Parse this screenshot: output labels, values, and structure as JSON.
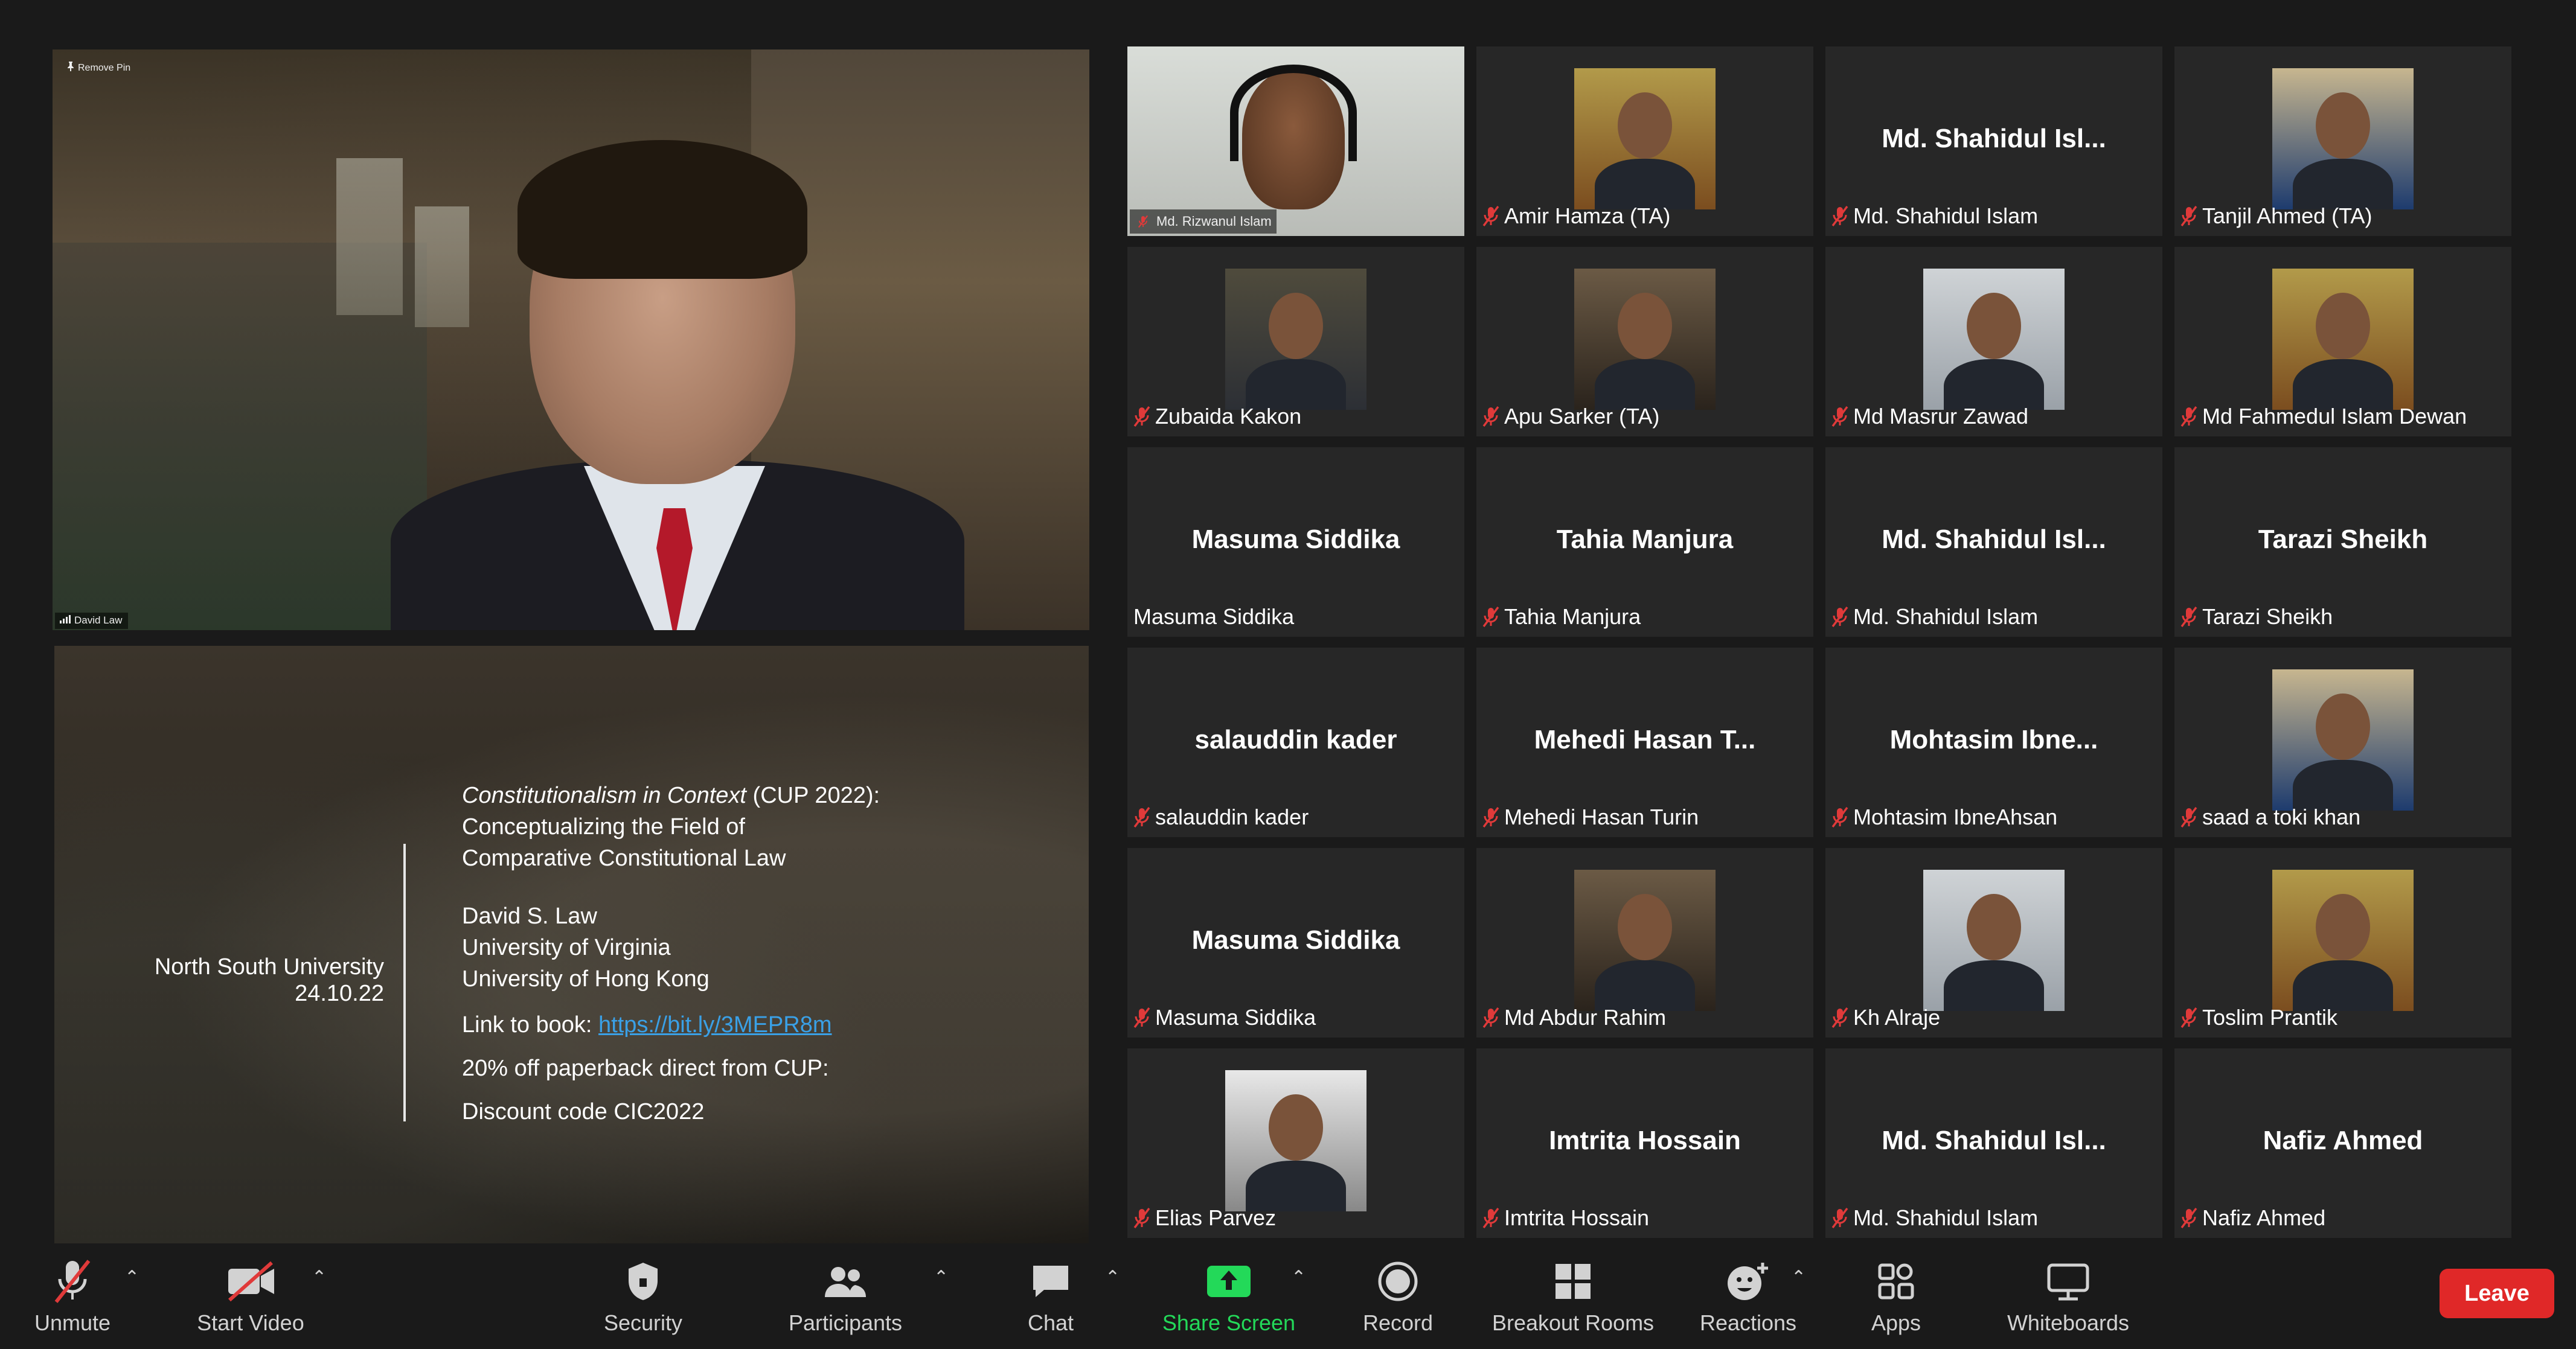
{
  "pinned_video": {
    "remove_pin_label": "Remove Pin",
    "speaker_name": "David Law"
  },
  "shared_screen": {
    "left_institution": "North South University",
    "left_date": "24.10.22",
    "title_italic": "Constitutionalism in Context",
    "title_rest": " (CUP 2022):",
    "title_line2": "Conceptualizing the Field of",
    "title_line3": "Comparative Constitutional Law",
    "author": "David S. Law",
    "affiliation_1": "University of Virginia",
    "affiliation_2": "University of Hong Kong",
    "link_label": "Link to book: ",
    "link_url": "https://bit.ly/3MEPR8m",
    "discount_line": "20% off paperback direct from CUP:",
    "discount_code": "Discount code CIC2022"
  },
  "participants": [
    {
      "label": "Md. Rizwanul Islam",
      "display": "video"
    },
    {
      "label": "Amir Hamza (TA)",
      "display": "photo"
    },
    {
      "label": "Md. Shahidul Islam",
      "big_name": "Md. Shahidul Isl..."
    },
    {
      "label": "Tanjil Ahmed (TA)",
      "display": "photo"
    },
    {
      "label": "Zubaida Kakon",
      "display": "photo"
    },
    {
      "label": "Apu Sarker (TA)",
      "display": "photo"
    },
    {
      "label": "Md Masrur Zawad",
      "display": "photo"
    },
    {
      "label": "Md Fahmedul Islam Dewan",
      "display": "photo"
    },
    {
      "label": "Masuma Siddika",
      "big_name": "Masuma Siddika"
    },
    {
      "label": "Tahia Manjura",
      "big_name": "Tahia Manjura"
    },
    {
      "label": "Md. Shahidul Islam",
      "big_name": "Md. Shahidul Isl..."
    },
    {
      "label": "Tarazi Sheikh",
      "big_name": "Tarazi Sheikh"
    },
    {
      "label": "salauddin kader",
      "big_name": "salauddin kader"
    },
    {
      "label": "Mehedi Hasan Turin",
      "big_name": "Mehedi Hasan T..."
    },
    {
      "label": "Mohtasim IbneAhsan",
      "big_name": "Mohtasim Ibne..."
    },
    {
      "label": "saad a toki khan",
      "display": "photo"
    },
    {
      "label": "Masuma Siddika",
      "big_name": "Masuma Siddika"
    },
    {
      "label": "Md Abdur Rahim",
      "display": "photo"
    },
    {
      "label": "Kh Alraje",
      "display": "photo"
    },
    {
      "label": "Toslim Prantik",
      "display": "photo"
    },
    {
      "label": "Elias Parvez",
      "display": "photo"
    },
    {
      "label": "Imtrita Hossain",
      "big_name": "Imtrita Hossain"
    },
    {
      "label": "Md. Shahidul Islam",
      "big_name": "Md. Shahidul Isl..."
    },
    {
      "label": "Nafiz Ahmed",
      "big_name": "Nafiz Ahmed"
    }
  ],
  "toolbar": {
    "unmute": "Unmute",
    "start_video": "Start Video",
    "security": "Security",
    "participants": "Participants",
    "chat": "Chat",
    "share_screen": "Share Screen",
    "record": "Record",
    "breakout_rooms": "Breakout Rooms",
    "reactions": "Reactions",
    "apps": "Apps",
    "whiteboards": "Whiteboards",
    "leave": "Leave"
  },
  "colors": {
    "share_green": "#23d959",
    "leave_red": "#e02828",
    "muted_red": "#e03a3a",
    "link_blue": "#3aa0e6"
  }
}
